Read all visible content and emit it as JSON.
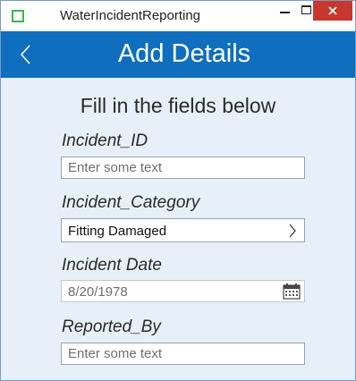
{
  "window": {
    "title": "WaterIncidentReporting",
    "close_icon": "close-icon",
    "minimize_icon": "minimize-icon",
    "maximize_icon": "maximize-icon",
    "accent_color": "#0f6ebd",
    "close_color": "#c7372d"
  },
  "header": {
    "title": "Add Details",
    "back_icon": "chevron-left-icon"
  },
  "form": {
    "subtitle": "Fill in the fields below",
    "incident_id": {
      "label": "Incident_ID",
      "value": "",
      "placeholder": "Enter some text"
    },
    "incident_category": {
      "label": "Incident_Category",
      "value": "Fitting Damaged",
      "icon": "chevron-right-icon"
    },
    "incident_date": {
      "label": "Incident Date",
      "value": "8/20/1978",
      "icon": "calendar-icon"
    },
    "reported_by": {
      "label": "Reported_By",
      "value": "",
      "placeholder": "Enter some text"
    }
  }
}
